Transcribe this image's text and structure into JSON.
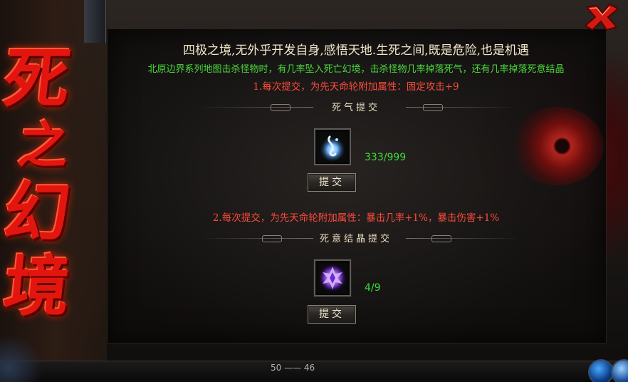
{
  "window": {
    "title_chars": [
      "死",
      "之",
      "幻",
      "境"
    ],
    "close_icon": "close-x-icon"
  },
  "intro": {
    "line1": "四极之境,无外乎开发自身,感悟天地.生死之间,既是危险,也是机遇",
    "line2": "北原边界系列地图击杀怪物时，有几率坠入死亡幻境，击杀怪物几率掉落死气，还有几率掉落死意结晶"
  },
  "section1": {
    "requirement": "1.每次提交，为先天命轮附加属性：固定攻击+9",
    "header": "死气提交",
    "item_icon": "death-qi-orb-icon",
    "count": "333/999",
    "button_label": "提交"
  },
  "section2": {
    "requirement": "2.每次提交，为先天命轮附加属性：暴击几率+1%，暴击伤害+1%",
    "header": "死意结晶提交",
    "item_icon": "death-crystal-icon",
    "count": "4/9",
    "button_label": "提交"
  },
  "hud": {
    "level_readout": "50 —— 46"
  },
  "colors": {
    "title_red": "#e2160f",
    "intro_text": "#f1e6c8",
    "green_text": "#4bd83c",
    "requirement_red": "#ff4a3a",
    "count_green": "#3ddc3a"
  }
}
